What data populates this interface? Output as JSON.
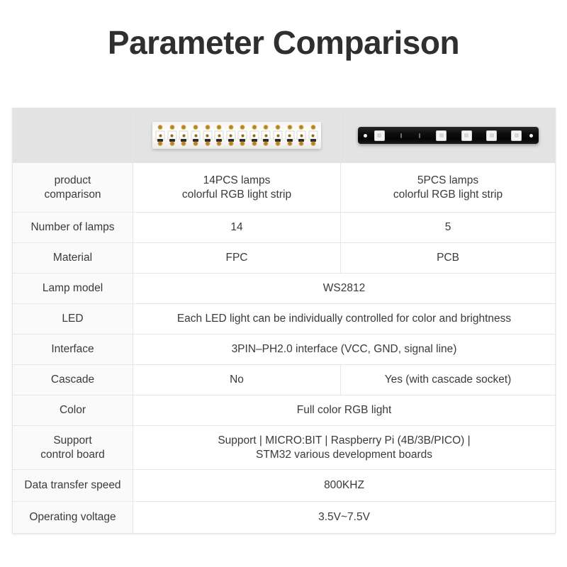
{
  "page": {
    "title": "Parameter Comparison",
    "accent_red": "#c4606a",
    "header_bg": "#e3e3e3",
    "label_bg": "#fafafa",
    "border_color": "#e6e6e6"
  },
  "products": {
    "left": {
      "image_name": "flexible-rgb-led-strip-14-lamps",
      "lamp_count": 14
    },
    "right": {
      "image_name": "rigid-black-pcb-led-bar-5-lamps",
      "lamp_count": 5
    }
  },
  "table": {
    "rows": [
      {
        "label": "product\ncomparison",
        "label_line1": "product",
        "label_line2": "comparison",
        "merged": false,
        "left_line1": "14PCS lamps",
        "left_line2": "colorful RGB light strip",
        "right_line1": "5PCS lamps",
        "right_line2": "colorful RGB light strip",
        "red": false
      },
      {
        "label": "Number of lamps",
        "merged": false,
        "left": "14",
        "right": "5",
        "red": true
      },
      {
        "label": "Material",
        "merged": false,
        "left": "FPC",
        "right": "PCB",
        "red": true
      },
      {
        "label": "Lamp model",
        "merged": true,
        "value": "WS2812",
        "red": false
      },
      {
        "label": "LED",
        "merged": true,
        "value": "Each LED light can be individually controlled for color and brightness",
        "red": false
      },
      {
        "label": "Interface",
        "merged": true,
        "value": "3PIN–PH2.0 interface (VCC, GND, signal line)",
        "red": false
      },
      {
        "label": "Cascade",
        "merged": false,
        "left": "No",
        "right": "Yes (with cascade socket)",
        "red": true
      },
      {
        "label": "Color",
        "merged": true,
        "value": "Full color RGB light",
        "red": false
      },
      {
        "label": "Support\ncontrol board",
        "label_line1": "Support",
        "label_line2": "control board",
        "merged": true,
        "value_line1": "Support | MICRO:BIT | Raspberry Pi (4B/3B/PICO) |",
        "value_line2": "STM32 various development boards",
        "red": false
      },
      {
        "label": "Data transfer speed",
        "merged": true,
        "value": "800KHZ",
        "red": false
      },
      {
        "label": "Operating voltage",
        "merged": true,
        "value": "3.5V~7.5V",
        "red": false
      }
    ]
  }
}
